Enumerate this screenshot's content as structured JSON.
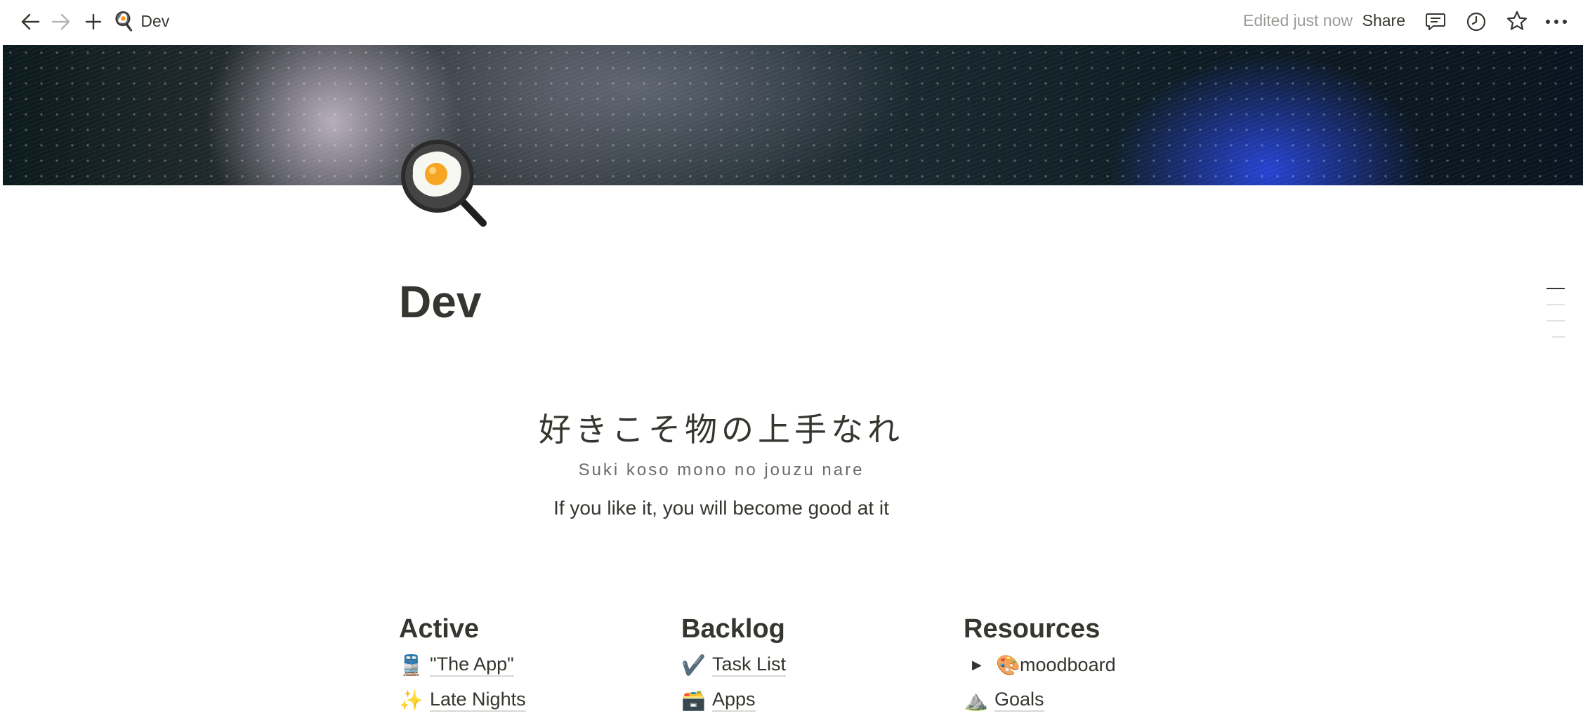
{
  "topbar": {
    "breadcrumb_emoji": "🍳",
    "breadcrumb_label": "Dev",
    "edited_text": "Edited just now",
    "share_label": "Share"
  },
  "page": {
    "icon": "🍳",
    "title": "Dev"
  },
  "quote": {
    "japanese": "好きこそ物の上手なれ",
    "romaji": "Suki koso mono no jouzu nare",
    "english": "If you like it, you will become good at it"
  },
  "columns": [
    {
      "heading": "Active",
      "items": [
        {
          "emoji": "🚆",
          "label": "\"The App\""
        },
        {
          "emoji": "✨",
          "label": "Late Nights"
        }
      ]
    },
    {
      "heading": "Backlog",
      "items": [
        {
          "emoji": "✔️",
          "label": "Task List"
        },
        {
          "emoji": "🗃️",
          "label": "Apps"
        }
      ]
    },
    {
      "heading": "Resources",
      "items": [
        {
          "emoji": "🎨",
          "label": "moodboard",
          "toggle": "▶"
        },
        {
          "emoji": "⛰️",
          "label": "Goals"
        }
      ]
    }
  ],
  "colors": {
    "text": "#37352f",
    "muted": "#9b9a97",
    "underline": "#d9d8d5"
  }
}
